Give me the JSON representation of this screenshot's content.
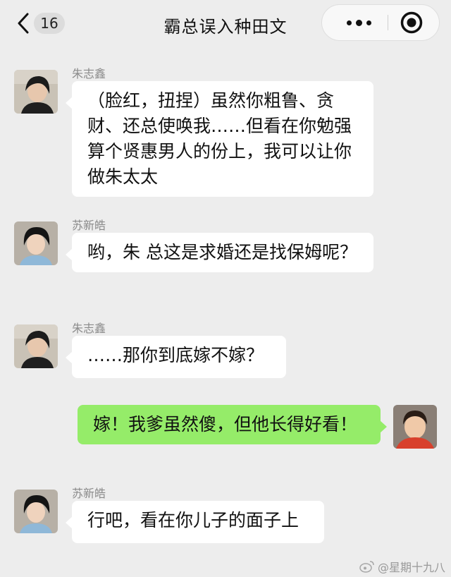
{
  "header": {
    "back_count": "16",
    "title": "霸总误入种田文"
  },
  "messages": [
    {
      "sender": "朱志鑫",
      "text": "（脸红，扭捏）虽然你粗鲁、贪财、还总使唤我……但看在你勉强算个贤惠男人的份上，我可以让你做朱太太"
    },
    {
      "sender": "苏新皓",
      "text": "哟，朱 总这是求婚还是找保姆呢？"
    },
    {
      "sender": "朱志鑫",
      "text": "……那你到底嫁不嫁？"
    },
    {
      "sender": "",
      "text": "嫁！我爹虽然傻，但他长得好看！"
    },
    {
      "sender": "苏新皓",
      "text": "行吧，看在你儿子的面子上"
    }
  ],
  "watermark": "@星期十九八",
  "colors": {
    "background": "#ededed",
    "bubble_other": "#ffffff",
    "bubble_self": "#95ec69"
  },
  "icons": [
    "back-chevron-icon",
    "more-dots-icon",
    "target-circle-icon",
    "weibo-logo-icon"
  ]
}
